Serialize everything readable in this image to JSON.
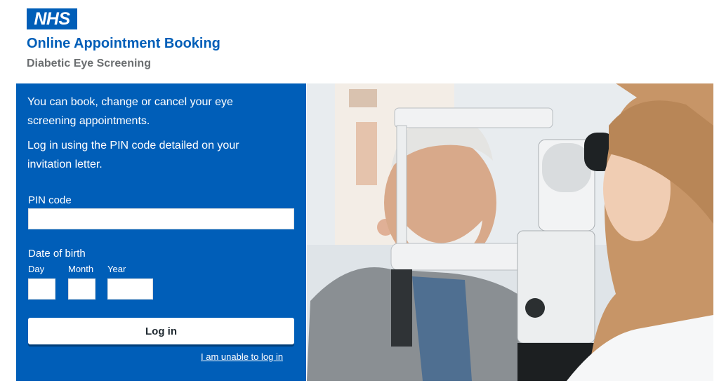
{
  "header": {
    "logo_text": "NHS",
    "title": "Online Appointment Booking",
    "subtitle": "Diabetic Eye Screening"
  },
  "form": {
    "intro_1": "You can book, change or cancel your eye screening appointments.",
    "intro_2": "Log in using the PIN code detailed on your invitation letter.",
    "pin_label": "PIN code",
    "pin_value": "",
    "dob_label": "Date of birth",
    "day_label": "Day",
    "month_label": "Month",
    "year_label": "Year",
    "day_value": "",
    "month_value": "",
    "year_value": "",
    "login_label": "Log in",
    "unable_link": "I am unable to log in"
  },
  "colors": {
    "brand": "#005eb8",
    "subtitle": "#6b6e70",
    "white": "#ffffff"
  },
  "photo": {
    "icon": "eye-examination-photo"
  }
}
